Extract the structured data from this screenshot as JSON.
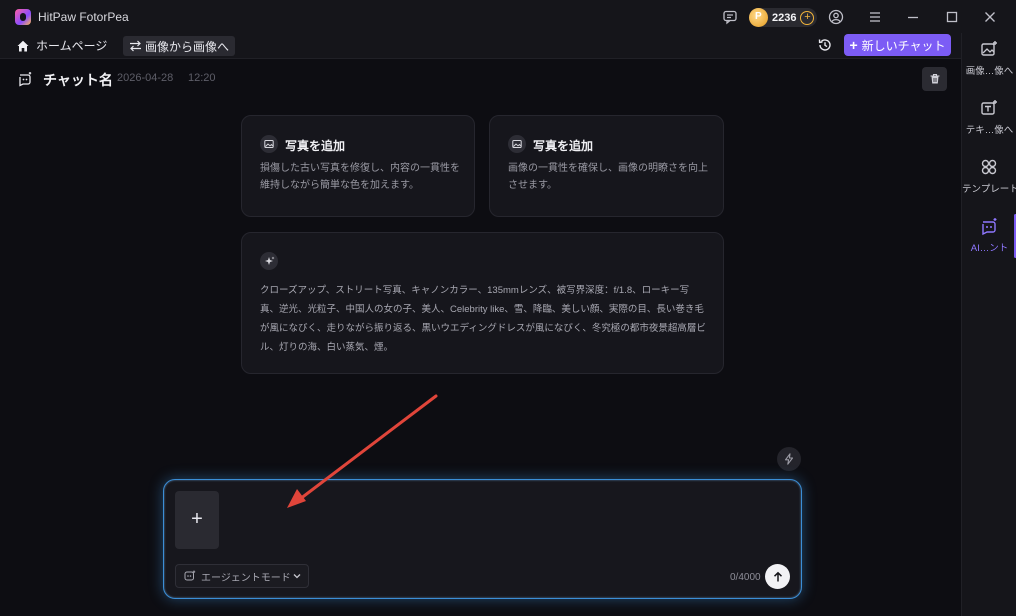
{
  "app": {
    "title": "HitPaw FotorPea",
    "coin_count": "2236"
  },
  "toolbar": {
    "home_label": "ホームページ",
    "mode_label": "画像から画像へ",
    "new_chat_label": "新しいチャット"
  },
  "sidebar": {
    "items": [
      {
        "label": "画像…像へ"
      },
      {
        "label": "テキ…像へ"
      },
      {
        "label": "テンプレート"
      },
      {
        "label": "AI…ント"
      }
    ],
    "active_index": 3
  },
  "chat": {
    "name": "チャット名",
    "date": "2026-04-28",
    "time": "12:20"
  },
  "cards": [
    {
      "title": "写真を追加",
      "description_lines": [
        "損傷した古い写真を修復し、内容の一貫性を",
        "維持しながら簡単な色を加えます。"
      ]
    },
    {
      "title": "写真を追加",
      "description_lines": [
        "画像の一貫性を確保し、画像の明瞭さを向上",
        "させます。"
      ]
    }
  ],
  "prompt_card": {
    "text": "クローズアップ、ストリート写真、キャノンカラー、135mmレンズ、被写界深度：f/1.8、ローキー写真、逆光、光粒子、中国人の女の子、美人、Celebrity like、雪、降臨、美しい顔、実際の目、長い巻き毛が風になびく、走りながら振り返る、黒いウエディングドレスが風になびく、冬究極の都市夜景超高層ビル、灯りの海、白い蒸気、煙。"
  },
  "composer": {
    "upload_label": "+",
    "agent_mode_label": "エージェントモード",
    "char_count": "0/4000"
  },
  "colors": {
    "accent": "#7c5cf5",
    "composer_glow": "#3b8ed6",
    "annotation_arrow": "#e0453a"
  }
}
